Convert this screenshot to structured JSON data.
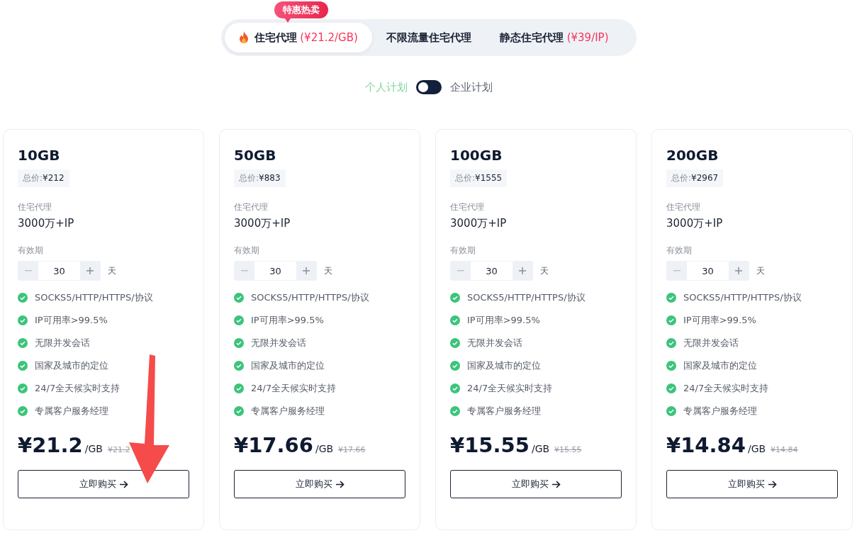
{
  "badge": "特惠热卖",
  "tabs": [
    {
      "label": "住宅代理",
      "price": "(¥21.2/GB)",
      "fire": true,
      "selected": true
    },
    {
      "label": "不限流量住宅代理",
      "fire": false,
      "selected": false
    },
    {
      "label": "静态住宅代理",
      "price": "(¥39/IP)",
      "fire": false,
      "selected": false
    }
  ],
  "plan_toggle": {
    "left_label": "个人计划",
    "right_label": "企业计划",
    "on": false
  },
  "annotation_arrow": true,
  "cards": [
    {
      "title": "10GB",
      "total_label": "总价:",
      "total": "¥212",
      "type_label": "住宅代理",
      "ips": "3000万+IP",
      "validity_label": "有效期",
      "days": "30",
      "unit": "天",
      "features": [
        "SOCKS5/HTTP/HTTPS/协议",
        "IP可用率>99.5%",
        "无限并发会话",
        "国家及城市的定位",
        "24/7全天候实时支持",
        "专属客户服务经理"
      ],
      "price": "¥21.2",
      "per": "/GB",
      "old_price": "¥21.2",
      "buy": "立即购买"
    },
    {
      "title": "50GB",
      "total_label": "总价:",
      "total": "¥883",
      "type_label": "住宅代理",
      "ips": "3000万+IP",
      "validity_label": "有效期",
      "days": "30",
      "unit": "天",
      "features": [
        "SOCKS5/HTTP/HTTPS/协议",
        "IP可用率>99.5%",
        "无限并发会话",
        "国家及城市的定位",
        "24/7全天候实时支持",
        "专属客户服务经理"
      ],
      "price": "¥17.66",
      "per": "/GB",
      "old_price": "¥17.66",
      "buy": "立即购买"
    },
    {
      "title": "100GB",
      "total_label": "总价:",
      "total": "¥1555",
      "type_label": "住宅代理",
      "ips": "3000万+IP",
      "validity_label": "有效期",
      "days": "30",
      "unit": "天",
      "features": [
        "SOCKS5/HTTP/HTTPS/协议",
        "IP可用率>99.5%",
        "无限并发会话",
        "国家及城市的定位",
        "24/7全天候实时支持",
        "专属客户服务经理"
      ],
      "price": "¥15.55",
      "per": "/GB",
      "old_price": "¥15.55",
      "buy": "立即购买"
    },
    {
      "title": "200GB",
      "total_label": "总价:",
      "total": "¥2967",
      "type_label": "住宅代理",
      "ips": "3000万+IP",
      "validity_label": "有效期",
      "days": "30",
      "unit": "天",
      "features": [
        "SOCKS5/HTTP/HTTPS/协议",
        "IP可用率>99.5%",
        "无限并发会话",
        "国家及城市的定位",
        "24/7全天候实时支持",
        "专属客户服务经理"
      ],
      "price": "¥14.84",
      "per": "/GB",
      "old_price": "¥14.84",
      "buy": "立即购买"
    }
  ]
}
